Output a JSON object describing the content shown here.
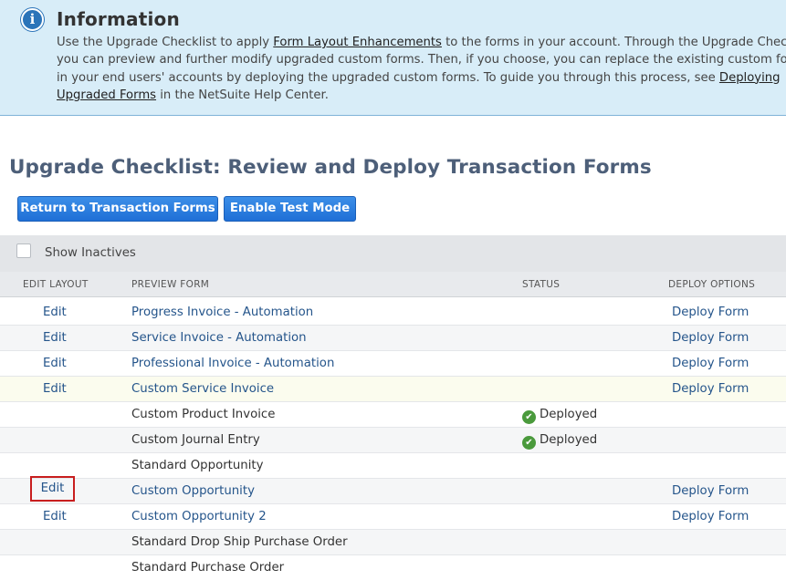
{
  "info": {
    "icon": "info-icon",
    "title": "Information",
    "line1_a": "Use the Upgrade Checklist to apply ",
    "line1_link": "Form Layout Enhancements",
    "line1_b": " to the forms in your account. Through the Upgrade Checklist,",
    "line2": "you can preview and further modify upgraded custom forms. Then, if you choose, you can replace the existing custom forms",
    "line3_a": "in your end users' accounts by deploying the upgraded custom forms. To guide you through this process, see ",
    "line3_link": "Deploying",
    "line4_link": "Upgraded Forms",
    "line4_b": " in the NetSuite Help Center."
  },
  "page_title": "Upgrade Checklist: Review and Deploy Transaction Forms",
  "buttons": {
    "return": "Return to Transaction Forms",
    "test_mode": "Enable Test Mode"
  },
  "filter": {
    "show_inactives_label": "Show Inactives",
    "show_inactives_checked": false
  },
  "columns": {
    "edit_layout": "EDIT LAYOUT",
    "preview_form": "PREVIEW FORM",
    "status": "STATUS",
    "deploy_options": "DEPLOY OPTIONS"
  },
  "rows": [
    {
      "edit": "Edit",
      "form": "Progress Invoice - Automation",
      "form_link": true,
      "status": "",
      "deploy": "Deploy Form"
    },
    {
      "edit": "Edit",
      "form": "Service Invoice - Automation",
      "form_link": true,
      "status": "",
      "deploy": "Deploy Form"
    },
    {
      "edit": "Edit",
      "form": "Professional Invoice - Automation",
      "form_link": true,
      "status": "",
      "deploy": "Deploy Form"
    },
    {
      "edit": "Edit",
      "form": "Custom Service Invoice",
      "form_link": true,
      "status": "",
      "deploy": "Deploy Form",
      "highlighted": true
    },
    {
      "edit": "",
      "form": "Custom Product Invoice",
      "form_link": false,
      "status": "Deployed",
      "deploy": ""
    },
    {
      "edit": "",
      "form": "Custom Journal Entry",
      "form_link": false,
      "status": "Deployed",
      "deploy": ""
    },
    {
      "edit": "",
      "form": "Standard Opportunity",
      "form_link": false,
      "status": "",
      "deploy": ""
    },
    {
      "edit": "Edit",
      "form": "Custom Opportunity",
      "form_link": true,
      "status": "",
      "deploy": "Deploy Form",
      "edit_boxed": true
    },
    {
      "edit": "Edit",
      "form": "Custom Opportunity 2",
      "form_link": true,
      "status": "",
      "deploy": "Deploy Form"
    },
    {
      "edit": "",
      "form": "Standard Drop Ship Purchase Order",
      "form_link": false,
      "status": "",
      "deploy": ""
    },
    {
      "edit": "",
      "form": "Standard Purchase Order",
      "form_link": false,
      "status": "",
      "deploy": ""
    }
  ],
  "status_icon": "check-circle-icon"
}
